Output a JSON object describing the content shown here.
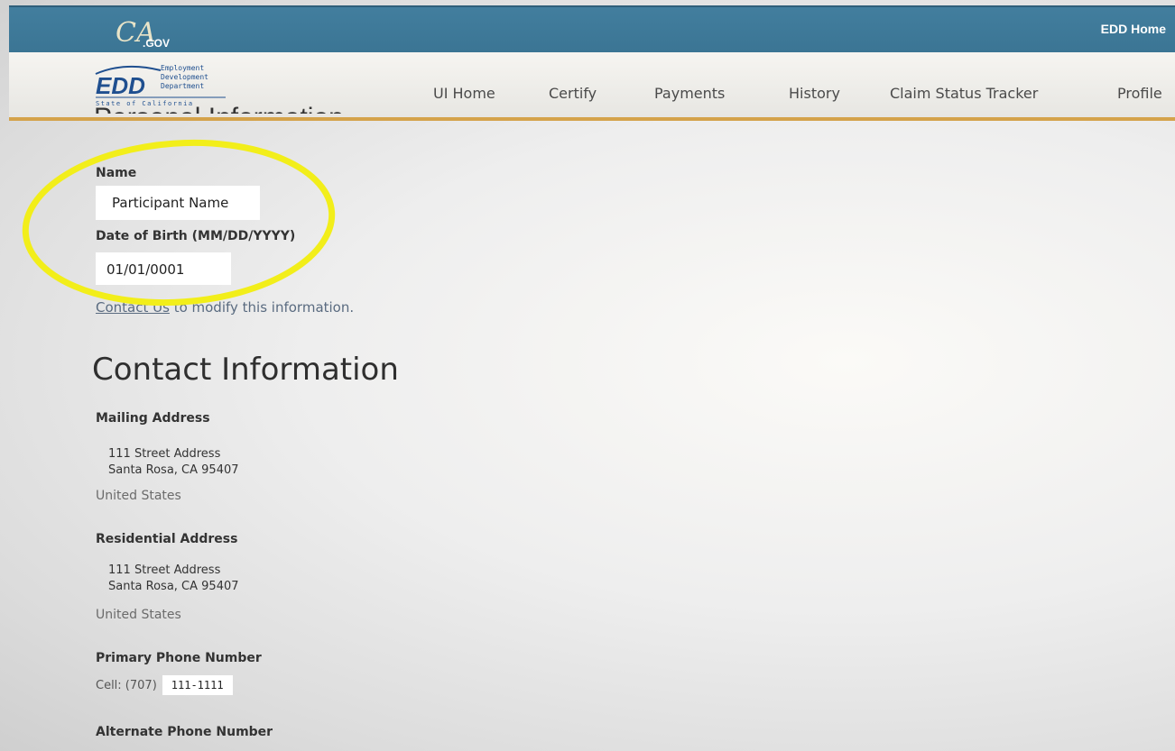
{
  "header": {
    "gov_logo_text": "CA.GOV",
    "edd_home_label": "EDD Home"
  },
  "logo": {
    "abbrev": "EDD",
    "line1": "Employment",
    "line2": "Development",
    "line3": "Department",
    "state": "State of California"
  },
  "nav": {
    "items": [
      {
        "label": "UI Home"
      },
      {
        "label": "Certify"
      },
      {
        "label": "Payments"
      },
      {
        "label": "History"
      },
      {
        "label": "Claim Status Tracker"
      },
      {
        "label": "Profile"
      }
    ]
  },
  "personal": {
    "heading": "Personal Information",
    "name_label": "Name",
    "name_value": "Participant Name",
    "dob_label": "Date of Birth (MM/DD/YYYY)",
    "dob_value": "01/01/0001",
    "modify_link": "Contact Us",
    "modify_text": " to modify this information."
  },
  "contact": {
    "heading": "Contact Information",
    "mailing": {
      "label": "Mailing Address",
      "line1": "111 Street Address",
      "line2": "Santa Rosa, CA 95407",
      "country": "United States"
    },
    "residential": {
      "label": "Residential Address",
      "line1": "111 Street Address",
      "line2": "Santa Rosa, CA 95407",
      "country": "United States"
    },
    "primary_phone": {
      "label": "Primary Phone Number",
      "prefix": "Cell: (707)",
      "number": "111-1111"
    },
    "alternate_phone": {
      "label": "Alternate Phone Number"
    }
  },
  "colors": {
    "state_bar": "#3b7594",
    "nav_underline": "#d4a24a",
    "highlight": "#f2ee1a",
    "edd_blue": "#1f4f8f"
  }
}
